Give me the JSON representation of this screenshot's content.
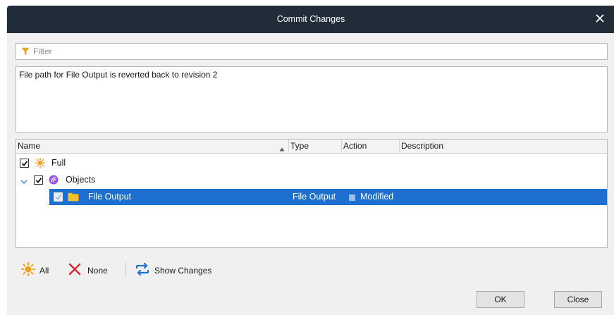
{
  "dialog": {
    "title": "Commit Changes",
    "close_glyph": "×"
  },
  "filter": {
    "placeholder": "Filter",
    "value": "",
    "icon": "funnel-icon",
    "icon_color": "#f2a020"
  },
  "message": {
    "value": "File path for File Output is reverted back to revision 2"
  },
  "tree": {
    "columns": {
      "name": "Name",
      "type": "Type",
      "action": "Action",
      "description": "Description"
    },
    "sort_indicator": "ascending-on-type",
    "rows": [
      {
        "label": "Full",
        "checked": true,
        "icon": "sun-icon",
        "expanded": null
      },
      {
        "label": "Objects",
        "checked": true,
        "icon": "objects-icon",
        "expanded": true
      },
      {
        "label": "File Output",
        "checked": true,
        "icon": "folder-icon",
        "type": "File Output",
        "action": "Modified",
        "selected": true
      }
    ]
  },
  "bottom": {
    "all_label": "All",
    "none_label": "None",
    "show_changes_label": "Show Changes"
  },
  "buttons": {
    "ok": "OK",
    "close": "Close"
  },
  "colors": {
    "titlebar": "#212c39",
    "selection": "#1f6fd0",
    "accent_orange": "#f2a020",
    "none_red": "#d9282f",
    "show_changes_blue": "#1a73d9",
    "objects_purple": "#9b51e0"
  }
}
